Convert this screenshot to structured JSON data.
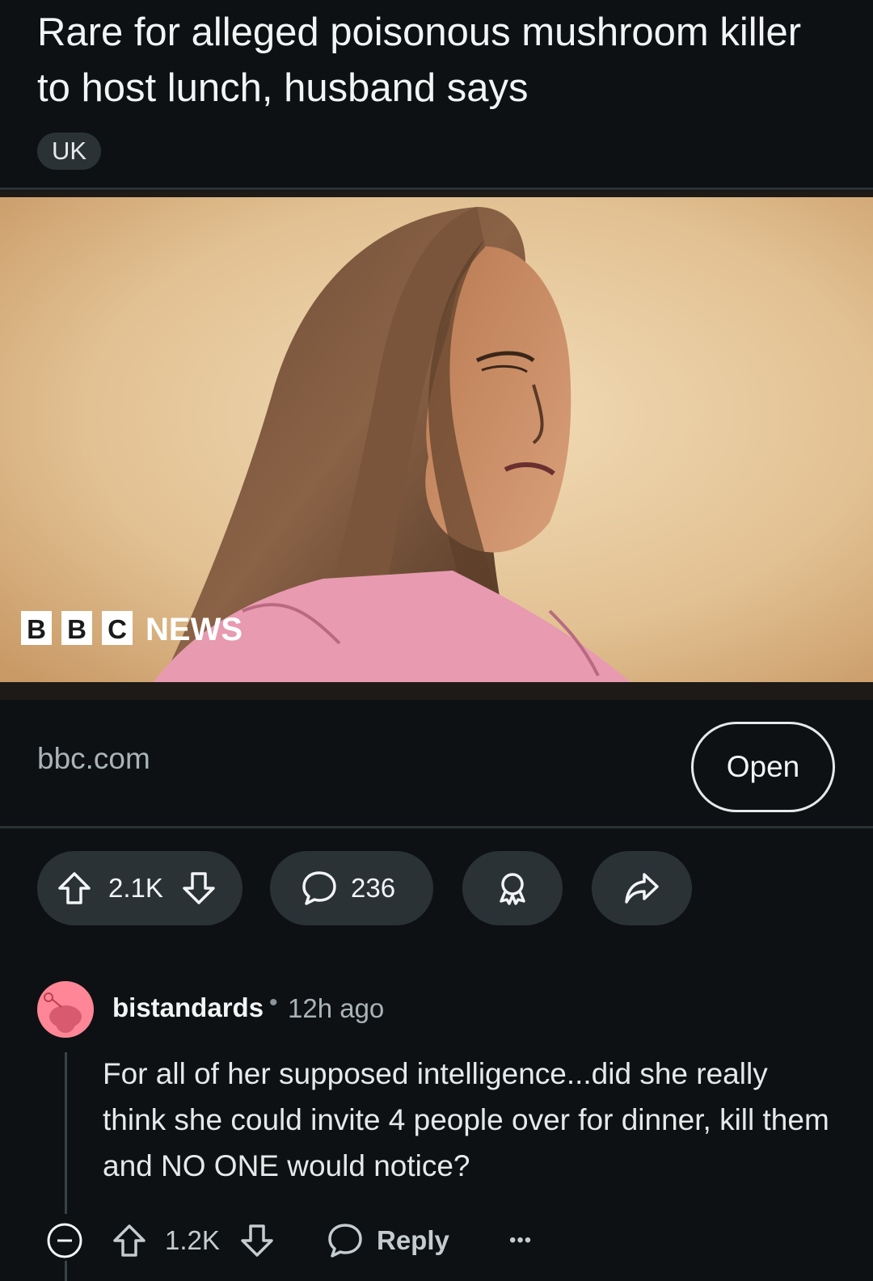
{
  "post": {
    "title": "Rare for alleged poisonous mushroom killer to host lunch, husband says",
    "flair": "UK",
    "image": {
      "logo_letters": [
        "B",
        "B",
        "C"
      ],
      "logo_word": "NEWS"
    },
    "domain": "bbc.com",
    "open_label": "Open",
    "votes": "2.1K",
    "comments": "236",
    "icons": {
      "upvote": "upvote-arrow-icon",
      "downvote": "downvote-arrow-icon",
      "comment": "speech-bubble-icon",
      "award": "award-icon",
      "share": "share-arrow-icon"
    }
  },
  "comment": {
    "username": "bistandards",
    "separator": "•",
    "time": "12h ago",
    "body": "For all of her supposed intelligence...did she really think she could invite 4 people over for dinner, kill them and NO ONE would notice?",
    "votes": "1.2K",
    "reply_label": "Reply",
    "more_label": "•••",
    "avatar_color": "#ff8696"
  },
  "colors": {
    "background": "#0e1113",
    "pill": "#2a3236",
    "text": "#f2f4f5",
    "muted": "#a9b3b8"
  }
}
